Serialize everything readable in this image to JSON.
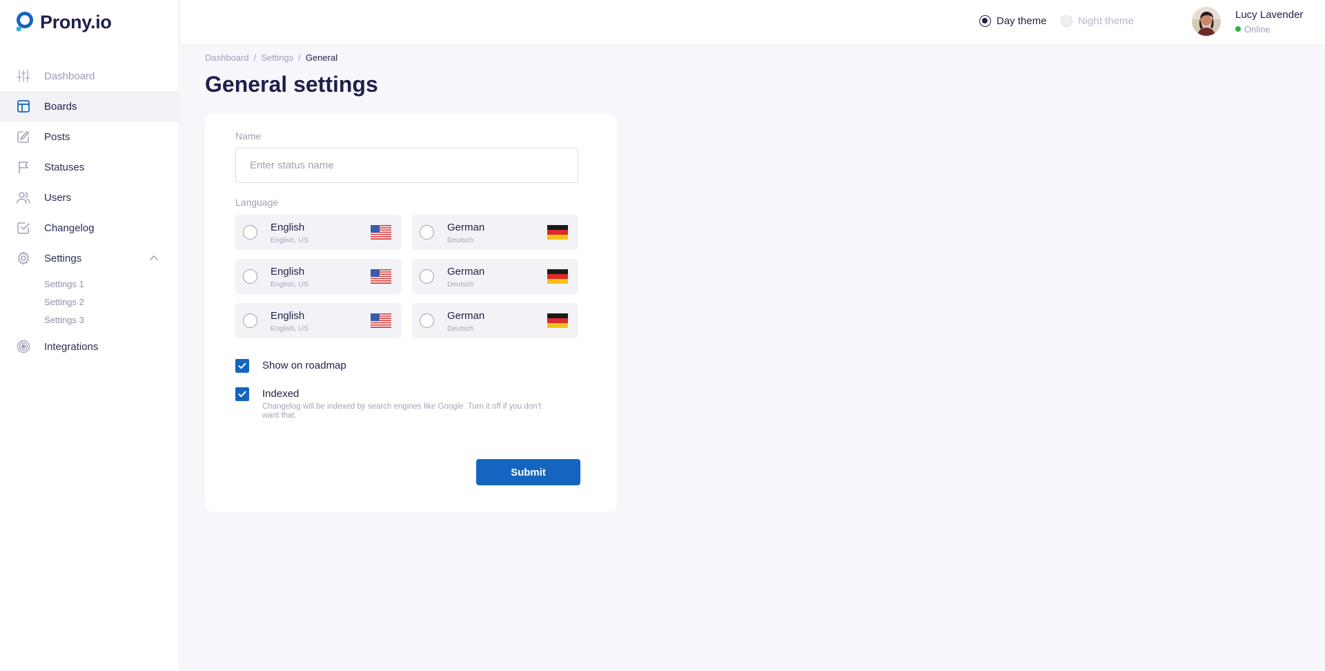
{
  "app": {
    "name": "Prony.io"
  },
  "sidebar": {
    "items": [
      {
        "label": "Dashboard",
        "icon": "sliders-icon",
        "state": "muted"
      },
      {
        "label": "Boards",
        "icon": "board-icon",
        "state": "active"
      },
      {
        "label": "Posts",
        "icon": "edit-icon",
        "state": "normal"
      },
      {
        "label": "Statuses",
        "icon": "flag-icon",
        "state": "normal"
      },
      {
        "label": "Users",
        "icon": "users-icon",
        "state": "normal"
      },
      {
        "label": "Changelog",
        "icon": "checklist-icon",
        "state": "normal"
      },
      {
        "label": "Settings",
        "icon": "gear-icon",
        "state": "expanded"
      },
      {
        "label": "Integrations",
        "icon": "target-icon",
        "state": "normal"
      }
    ],
    "settings_sub": [
      "Settings 1",
      "Settings 2",
      "Settings 3"
    ]
  },
  "header": {
    "themes": [
      {
        "label": "Day theme",
        "selected": true
      },
      {
        "label": "Night theme",
        "selected": false
      }
    ],
    "user": {
      "name": "Lucy Lavender",
      "status": "Online"
    }
  },
  "breadcrumb": [
    "Dashboard",
    "Settings",
    "General"
  ],
  "page": {
    "title": "General settings"
  },
  "form": {
    "name_label": "Name",
    "name_placeholder": "Enter status name",
    "name_value": "",
    "language_label": "Language",
    "languages": [
      {
        "title": "English",
        "subtitle": "English, US",
        "flag": "us-flag-icon"
      },
      {
        "title": "German",
        "subtitle": "Deutsch",
        "flag": "de-flag-icon"
      },
      {
        "title": "English",
        "subtitle": "English, US",
        "flag": "us-flag-icon"
      },
      {
        "title": "German",
        "subtitle": "Deutsch",
        "flag": "de-flag-icon"
      },
      {
        "title": "English",
        "subtitle": "English, US",
        "flag": "us-flag-icon"
      },
      {
        "title": "German",
        "subtitle": "Deutsch",
        "flag": "de-flag-icon"
      }
    ],
    "checkboxes": [
      {
        "label": "Show on roadmap",
        "checked": true,
        "help": ""
      },
      {
        "label": "Indexed",
        "checked": true,
        "help": "Changelog will be indexed by search engines like Google. Turn it off if you don't want that."
      }
    ],
    "submit_label": "Submit"
  },
  "colors": {
    "accent": "#1565c0",
    "brand_dark": "#1e1f4b",
    "online": "#2fb344",
    "page_bg": "#f7f7fb"
  }
}
